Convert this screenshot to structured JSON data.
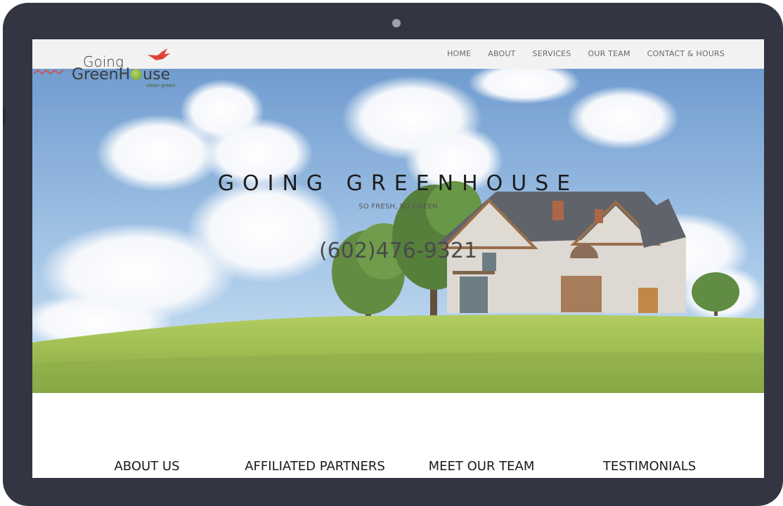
{
  "logo": {
    "line1": "Going",
    "line2_start": "GreenH",
    "line2_end": "use",
    "tagline": "clean green"
  },
  "nav": {
    "items": [
      "HOME",
      "ABOUT",
      "SERVICES",
      "OUR TEAM",
      "CONTACT & HOURS"
    ]
  },
  "hero": {
    "title": "GOING GREENHOUSE",
    "subtitle": "SO FRESH, SO GREEN",
    "phone": "(602)476-9321"
  },
  "features": {
    "items": [
      "ABOUT US",
      "AFFILIATED PARTNERS",
      "MEET OUR TEAM",
      "TESTIMONIALS"
    ]
  },
  "colors": {
    "frame": "#333642",
    "accent": "#e0463a",
    "nav_text": "#6a6a6a"
  }
}
